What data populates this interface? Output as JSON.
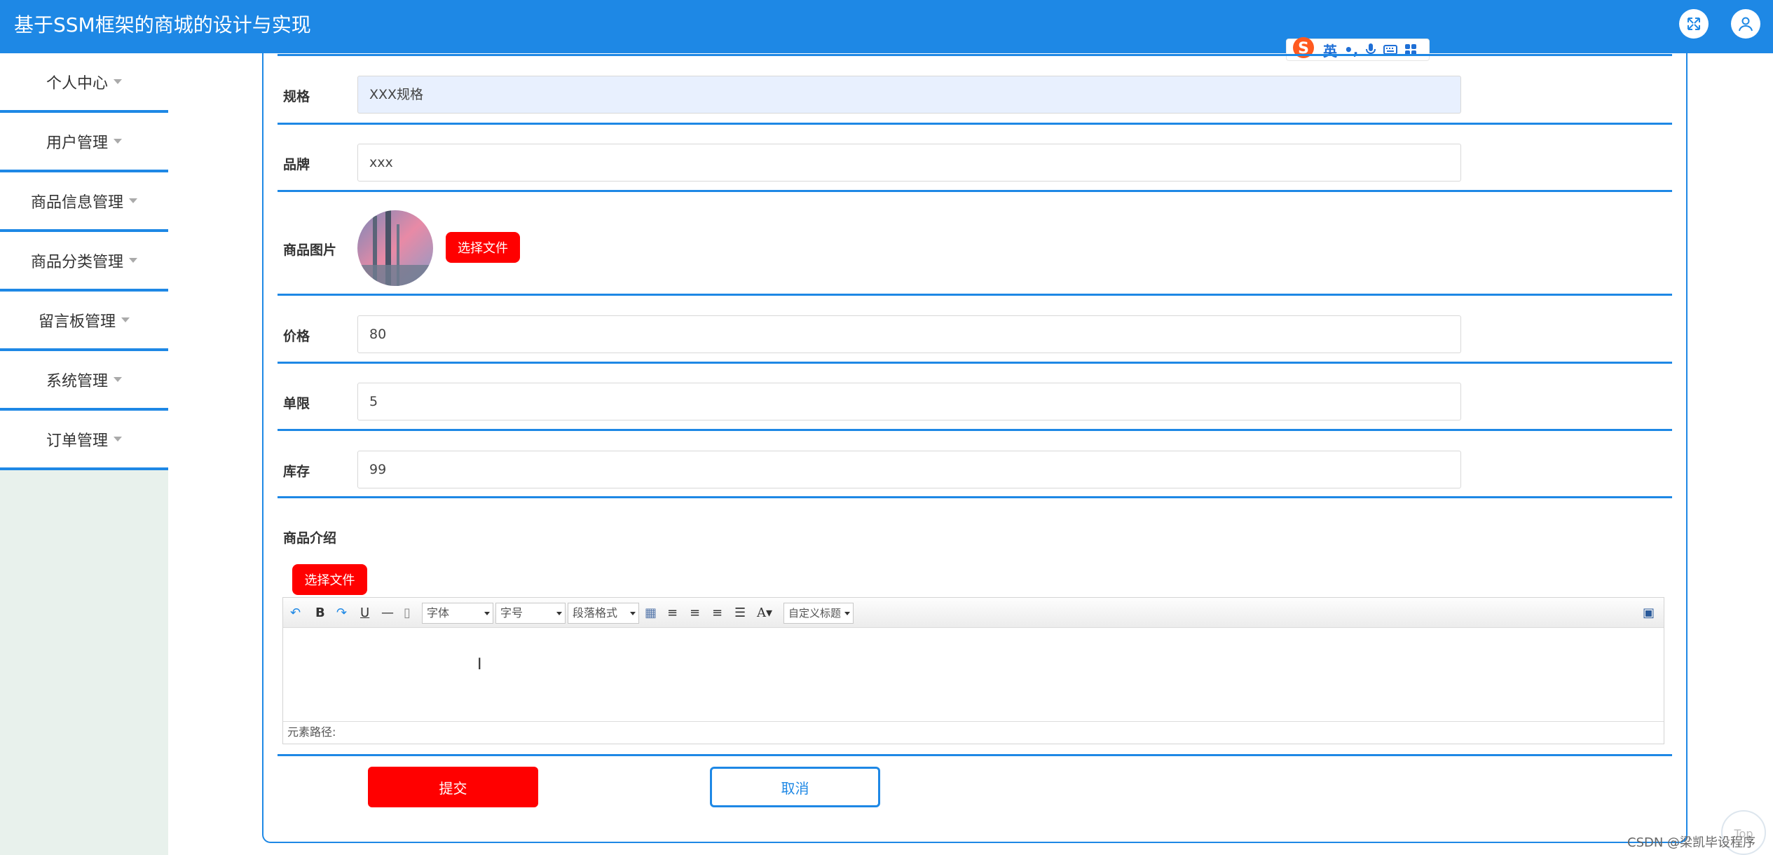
{
  "app": {
    "title": "基于SSM框架的商城的设计与实现"
  },
  "ime": {
    "lang": "英",
    "punct": "•,"
  },
  "sidebar": {
    "items": [
      {
        "label": "个人中心"
      },
      {
        "label": "用户管理"
      },
      {
        "label": "商品信息管理"
      },
      {
        "label": "商品分类管理"
      },
      {
        "label": "留言板管理"
      },
      {
        "label": "系统管理"
      },
      {
        "label": "订单管理"
      }
    ]
  },
  "form": {
    "spec": {
      "label": "规格",
      "value": "XXX规格"
    },
    "brand": {
      "label": "品牌",
      "value": "xxx"
    },
    "image": {
      "label": "商品图片",
      "button": "选择文件"
    },
    "price": {
      "label": "价格",
      "value": "80"
    },
    "limit": {
      "label": "单限",
      "value": "5"
    },
    "stock": {
      "label": "库存",
      "value": "99"
    },
    "intro": {
      "label": "商品介绍",
      "button": "选择文件"
    }
  },
  "editor": {
    "font": "字体",
    "size": "字号",
    "paragraph": "段落格式",
    "custom": "自定义标题",
    "path": "元素路径:"
  },
  "actions": {
    "submit": "提交",
    "cancel": "取消"
  },
  "footer": {
    "watermark": "CSDN @梁凯毕设程序",
    "top": "Top"
  },
  "colors": {
    "primary": "#1e88e5",
    "danger": "#ff0000",
    "sidebar_bg": "#e8f1ec"
  }
}
